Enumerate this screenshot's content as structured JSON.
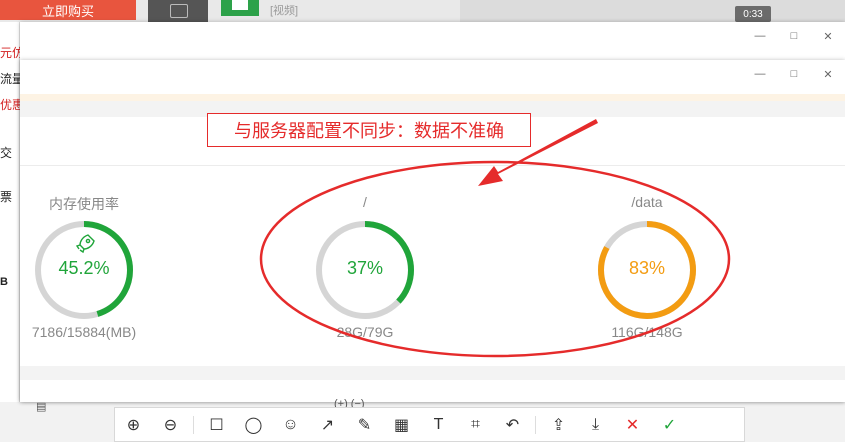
{
  "background": {
    "buy_button": "立即购买",
    "video_tag": "[视频]",
    "video_time": "0:33",
    "left_texts": [
      "元仿",
      "流量",
      "优惠",
      "交",
      "票",
      "B"
    ],
    "under_text": "(+) (−)"
  },
  "outer_window": {
    "minimize": "—",
    "maximize": "□",
    "close": "✕"
  },
  "inner_window": {
    "minimize": "—",
    "maximize": "□",
    "close": "✕"
  },
  "annotation": {
    "text": "与服务器配置不同步：数据不准确",
    "color": "#e52b2b"
  },
  "gauges": [
    {
      "label": "内存使用率",
      "value": "45.2%",
      "percent": 45.2,
      "foot": "7186/15884(MB)",
      "color": "#20a53a",
      "icon": "rocket-icon"
    },
    {
      "label": "/",
      "value": "37%",
      "percent": 37,
      "foot": "28G/79G",
      "color": "#20a53a"
    },
    {
      "label": "/data",
      "value": "83%",
      "percent": 83,
      "foot": "116G/148G",
      "color": "#f39c12"
    }
  ],
  "toolbar": {
    "items": [
      {
        "name": "zoom-in-icon",
        "glyph": "⊕"
      },
      {
        "name": "zoom-out-icon",
        "glyph": "⊖"
      },
      {
        "name": "rectangle-icon",
        "glyph": "☐"
      },
      {
        "name": "ellipse-icon",
        "glyph": "◯"
      },
      {
        "name": "emoji-icon",
        "glyph": "☺"
      },
      {
        "name": "arrow-icon",
        "glyph": "↗"
      },
      {
        "name": "pen-icon",
        "glyph": "✎"
      },
      {
        "name": "mosaic-icon",
        "glyph": "▦"
      },
      {
        "name": "text-icon",
        "glyph": "T"
      },
      {
        "name": "crop-icon",
        "glyph": "⌗"
      },
      {
        "name": "undo-icon",
        "glyph": "↶"
      },
      {
        "name": "share-icon",
        "glyph": "⇪"
      },
      {
        "name": "download-icon",
        "glyph": "⤓"
      },
      {
        "name": "cancel-icon",
        "glyph": "✕"
      },
      {
        "name": "confirm-icon",
        "glyph": "✓"
      }
    ],
    "cancel_color": "#e52b2b",
    "confirm_color": "#20a53a"
  }
}
